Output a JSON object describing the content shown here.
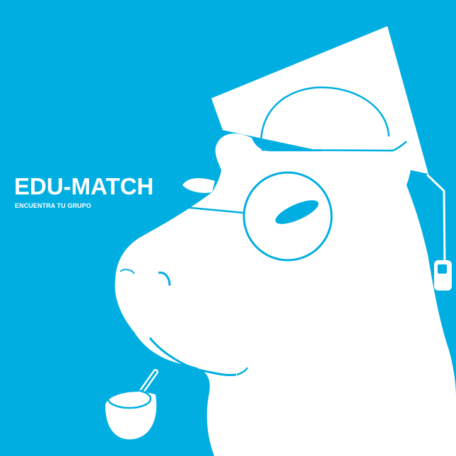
{
  "brand": {
    "title": "EDU-MATCH",
    "tagline": "ENCUENTRA TU GRUPO"
  },
  "illustration": {
    "subject": "capybara-graduate-icon",
    "accessories": [
      "graduation-cap-icon",
      "round-glasses-icon",
      "pipe-icon"
    ]
  },
  "colors": {
    "background": "#00AEE2",
    "foreground": "#FFFFFF"
  }
}
